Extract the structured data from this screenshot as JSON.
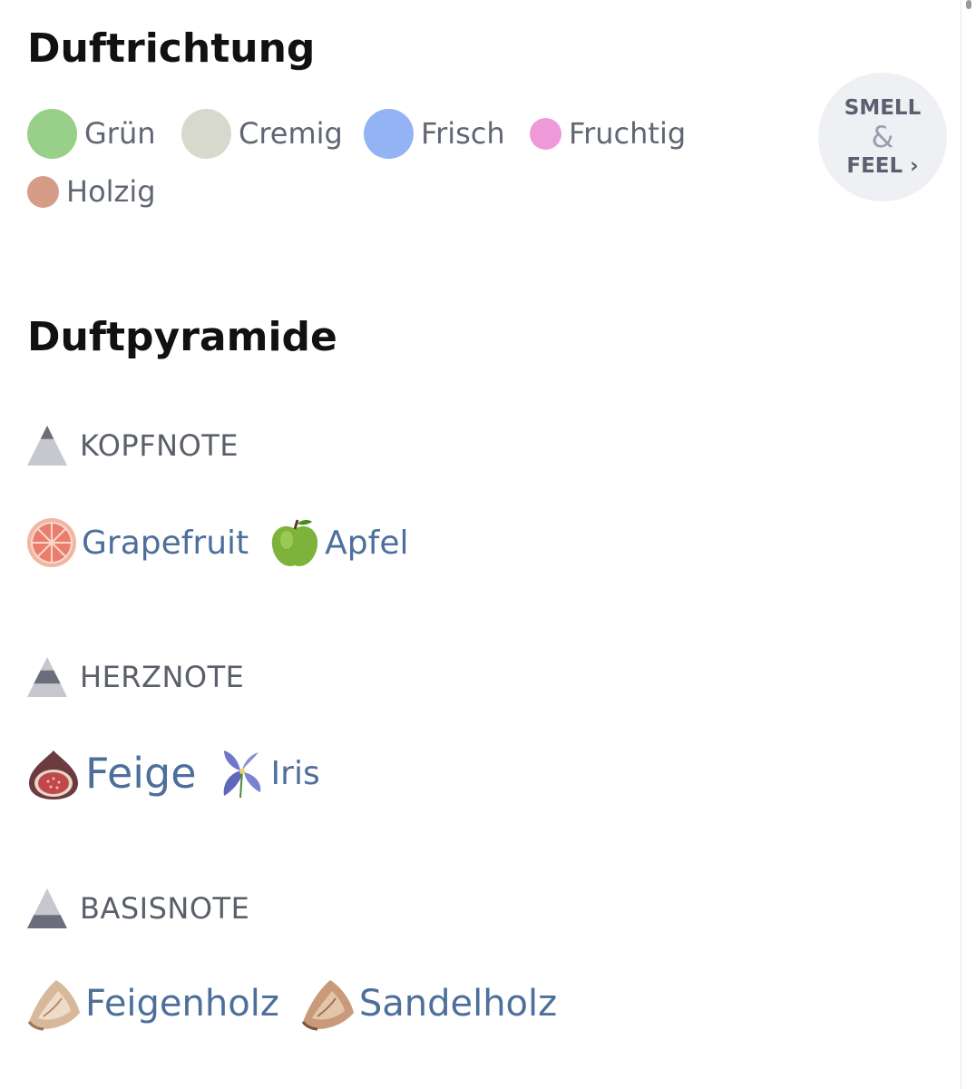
{
  "scent": {
    "title": "Duftrichtung",
    "families": [
      {
        "label": "Grün",
        "color": "#98d08a"
      },
      {
        "label": "Cremig",
        "color": "#d8d9cd"
      },
      {
        "label": "Frisch",
        "color": "#93b3f5"
      },
      {
        "label": "Fruchtig",
        "color": "#ef9ad8"
      },
      {
        "label": "Holzig",
        "color": "#d69c88"
      }
    ],
    "badge": {
      "line1": "SMELL",
      "amp": "&",
      "line2": "FEEL ›"
    }
  },
  "pyramid": {
    "title": "Duftpyramide",
    "top": {
      "label": "KOPFNOTE",
      "items": [
        {
          "label": "Grapefruit",
          "icon": "grapefruit-icon"
        },
        {
          "label": "Apfel",
          "icon": "apple-icon"
        }
      ]
    },
    "heart": {
      "label": "HERZNOTE",
      "items": [
        {
          "label": "Feige",
          "icon": "fig-icon"
        },
        {
          "label": "Iris",
          "icon": "iris-icon"
        }
      ]
    },
    "base": {
      "label": "BASISNOTE",
      "items": [
        {
          "label": "Feigenholz",
          "icon": "wood-icon"
        },
        {
          "label": "Sandelholz",
          "icon": "wood-icon"
        }
      ]
    }
  },
  "colors": {
    "accent_link": "#4d6f9b",
    "pyramid_dark": "#6b6d7c",
    "pyramid_light": "#c7c8ce"
  }
}
